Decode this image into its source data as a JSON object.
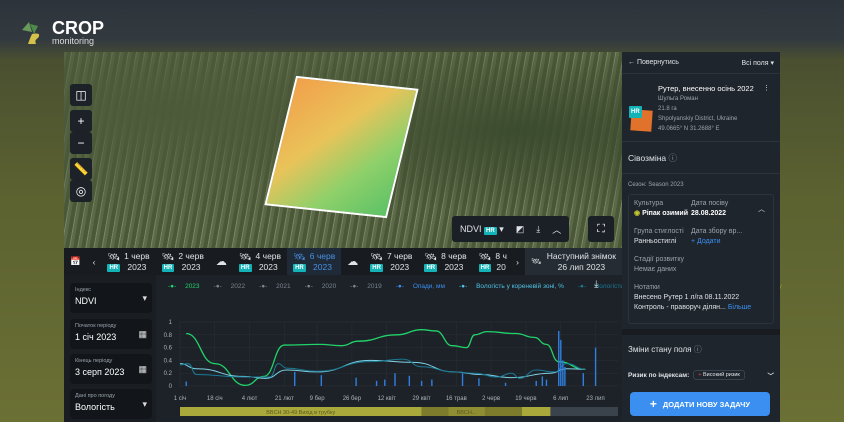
{
  "app": {
    "logo_title": "CROP",
    "logo_subtitle": "monitoring"
  },
  "map": {
    "index_label": "NDVI",
    "hr_badge": "HR"
  },
  "timeline": {
    "items": [
      {
        "day": "1 черв",
        "year": "2023",
        "icon": "satellite-icon",
        "hr": true
      },
      {
        "day": "2 черв",
        "year": "2023",
        "icon": "satellite-icon",
        "hr": true
      },
      {
        "icon": "cloud-icon"
      },
      {
        "day": "4 черв",
        "year": "2023",
        "icon": "satellite-icon",
        "hr": true
      },
      {
        "day": "6 черв",
        "year": "2023",
        "icon": "satellite-icon",
        "hr": true,
        "selected": true
      },
      {
        "icon": "cloud-icon"
      },
      {
        "day": "7 черв",
        "year": "2023",
        "icon": "satellite-icon",
        "hr": true
      },
      {
        "day": "8 черв",
        "year": "2023",
        "icon": "satellite-icon",
        "hr": true
      },
      {
        "day": "8 ч",
        "year": "20",
        "icon": "satellite-icon",
        "hr": true
      }
    ],
    "next_label": "Наступний знімок",
    "next_date": "26 лип 2023"
  },
  "controls": {
    "index": {
      "label": "Індекс",
      "value": "NDVI"
    },
    "start": {
      "label": "Початок періоду",
      "value": "1 січ 2023"
    },
    "end": {
      "label": "Кінець періоду",
      "value": "3 серп 2023"
    },
    "weather": {
      "label": "Дані про погоду",
      "value": "Вологість"
    }
  },
  "colors": {
    "ndvi2023": "#22d36a",
    "root": "#7fd3e6",
    "surface": "#1a7a94",
    "precip": "#2f7fe0",
    "stage": "#a9a83a",
    "past": "#7a8490"
  },
  "chart_data": {
    "type": "line",
    "legend": [
      {
        "name": "2023",
        "color": "#22d36a"
      },
      {
        "name": "2022",
        "color": "#7a8490"
      },
      {
        "name": "2021",
        "color": "#7a8490"
      },
      {
        "name": "2020",
        "color": "#7a8490"
      },
      {
        "name": "2019",
        "color": "#7a8490"
      },
      {
        "name": "Опади, мм",
        "color": "#3a8ff0"
      },
      {
        "name": "Вологість у кореневій зоні, %",
        "color": "#4fc3e6"
      },
      {
        "name": "Вологість поверхневого шару ґрунту, %",
        "color": "#1a7a94"
      },
      {
        "name": "Стадії росту",
        "color": "#a9a83a"
      }
    ],
    "xlim": [
      "2023-01-01",
      "2023-08-03"
    ],
    "ylim": [
      0,
      1
    ],
    "yticks": [
      "0",
      "0.2",
      "0.4",
      "0.6",
      "0.8",
      "1"
    ],
    "xticks": [
      {
        "date": "2023-01-01",
        "label": "1 січ"
      },
      {
        "date": "2023-01-18",
        "label": "18 січ"
      },
      {
        "date": "2023-02-04",
        "label": "4 лют"
      },
      {
        "date": "2023-02-21",
        "label": "21 лют"
      },
      {
        "date": "2023-03-09",
        "label": "9 бер"
      },
      {
        "date": "2023-03-26",
        "label": "26 бер"
      },
      {
        "date": "2023-04-12",
        "label": "12 квіт"
      },
      {
        "date": "2023-04-29",
        "label": "29 квіт"
      },
      {
        "date": "2023-05-16",
        "label": "16 трав"
      },
      {
        "date": "2023-06-02",
        "label": "2 черв"
      },
      {
        "date": "2023-06-19",
        "label": "19 черв"
      },
      {
        "date": "2023-07-06",
        "label": "6 лип"
      },
      {
        "date": "2023-07-23",
        "label": "23 лип"
      }
    ],
    "grid": true,
    "series": [
      {
        "name": "2023",
        "x": [
          "2023-01-04",
          "2023-01-18",
          "2023-02-02",
          "2023-02-11",
          "2023-02-21",
          "2023-03-10",
          "2023-03-21",
          "2023-03-29",
          "2023-04-17",
          "2023-04-29",
          "2023-05-06",
          "2023-05-14",
          "2023-05-21",
          "2023-05-25",
          "2023-05-31",
          "2023-06-14",
          "2023-06-23",
          "2023-06-29",
          "2023-07-05",
          "2023-07-18"
        ],
        "y": [
          0.82,
          0.35,
          0.01,
          0.15,
          0.64,
          0.65,
          0.63,
          0.7,
          0.8,
          0.88,
          0.86,
          0.63,
          0.6,
          0.8,
          0.85,
          0.82,
          0.76,
          0.65,
          0.38,
          0.26
        ]
      },
      {
        "name": "Вологість у кореневій зоні, %",
        "x": [
          "2023-01-01",
          "2023-01-09",
          "2023-02-01",
          "2023-02-12",
          "2023-02-22",
          "2023-03-09",
          "2023-04-04",
          "2023-04-25",
          "2023-05-15",
          "2023-05-28",
          "2023-06-12",
          "2023-07-01",
          "2023-07-09",
          "2023-07-18"
        ],
        "y": [
          0.35,
          0.27,
          0.15,
          0.12,
          0.25,
          0.22,
          0.4,
          0.37,
          0.22,
          0.18,
          0.13,
          0.2,
          0.27,
          0.26
        ]
      },
      {
        "name": "Вологість поверхневого шару ґрунту, %",
        "x": [
          "2023-01-01",
          "2023-01-05",
          "2023-01-09",
          "2023-02-01",
          "2023-02-14",
          "2023-02-18",
          "2023-02-22",
          "2023-03-09",
          "2023-04-04",
          "2023-04-20",
          "2023-04-29",
          "2023-05-15",
          "2023-05-25",
          "2023-06-05",
          "2023-06-12",
          "2023-06-16",
          "2023-06-24",
          "2023-07-03",
          "2023-07-09",
          "2023-07-18"
        ],
        "y": [
          0.33,
          0.35,
          0.18,
          0.14,
          0.14,
          0.35,
          0.28,
          0.23,
          0.38,
          0.42,
          0.3,
          0.22,
          0.2,
          0.14,
          0.2,
          0.12,
          0.25,
          0.22,
          0.35,
          0.26
        ]
      },
      {
        "name": "Опади, мм",
        "type": "bar",
        "x": [
          "2023-01-04",
          "2023-02-26",
          "2023-03-11",
          "2023-03-28",
          "2023-04-07",
          "2023-04-11",
          "2023-04-16",
          "2023-04-23",
          "2023-04-29",
          "2023-05-04",
          "2023-05-19",
          "2023-05-27",
          "2023-06-09",
          "2023-06-24",
          "2023-06-27",
          "2023-06-29",
          "2023-07-05",
          "2023-07-06",
          "2023-07-07",
          "2023-07-08",
          "2023-07-17",
          "2023-07-23"
        ],
        "y": [
          0.07,
          0.22,
          0.17,
          0.13,
          0.08,
          0.1,
          0.2,
          0.16,
          0.08,
          0.1,
          0.2,
          0.12,
          0.05,
          0.08,
          0.15,
          0.1,
          0.86,
          0.72,
          0.4,
          0.3,
          0.2,
          0.6
        ]
      }
    ],
    "growth_stages": [
      {
        "label": "BBCH 30-49 Вихід в трубку",
        "from": "2023-01-01",
        "to": "2023-04-29",
        "color": "#a9a83a"
      },
      {
        "label": "",
        "from": "2023-04-29",
        "to": "2023-05-12",
        "color": "#7d7c2c"
      },
      {
        "label": "BBCH...",
        "from": "2023-05-12",
        "to": "2023-05-30",
        "color": "#8f8e33"
      },
      {
        "label": "",
        "from": "2023-05-30",
        "to": "2023-06-17",
        "color": "#7d7c2c"
      },
      {
        "label": "",
        "from": "2023-06-17",
        "to": "2023-07-01",
        "color": "#a9a83a"
      },
      {
        "label": "",
        "from": "2023-07-01",
        "to": "2023-08-03",
        "color": "#3a424c"
      }
    ]
  },
  "right": {
    "back": "Повернутись",
    "all_fields": "Всі поля",
    "field": {
      "name": "Рутер, внесенно осінь 2022",
      "owner": "Шульга Роман",
      "area": "21.8 га",
      "district": "Shpolyanskiy District, Ukraine",
      "coords": "49.0665° N 31.2688° E",
      "hr": "HR"
    },
    "rotation_title": "Сівозміна",
    "season": "Сезон: Season 2023",
    "crop_label": "Культура",
    "crop": "Ріпак озимий",
    "sowing_label": "Дата посіву",
    "sowing": "28.08.2022",
    "maturity_label": "Група стиглості",
    "maturity": "Ранньостиглі",
    "harvest_label": "Дата збору вр...",
    "harvest_add": "+ Додати",
    "stage_label": "Стадії розвитку",
    "stage": "Немає даних",
    "notes_label": "Нотатки",
    "note1": "Внесено Рутер 1 л/га 08.11.2022",
    "note2": "Контроль - праворуч ділян...",
    "more": "Більше",
    "changes_title": "Зміни стану поля",
    "risk_label": "Ризик по індексам:",
    "risk": "Високий ризик",
    "add_task": "ДОДАТИ НОВУ ЗАДАЧУ"
  }
}
